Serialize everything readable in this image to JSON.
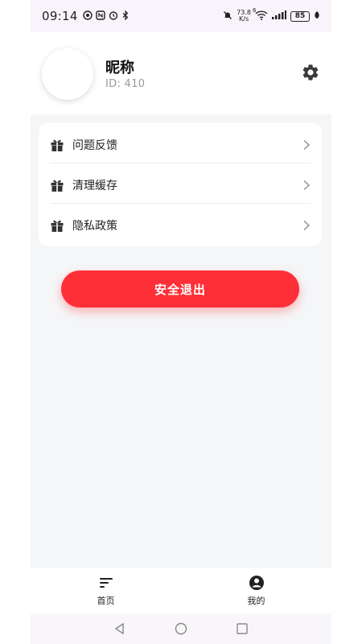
{
  "status_bar": {
    "time": "09:14",
    "net_speed_value": "73.8",
    "net_speed_unit": "K/s",
    "wifi_label": "6",
    "battery": "85"
  },
  "profile": {
    "nickname": "昵称",
    "id_text": "ID:  410"
  },
  "menu": {
    "items": [
      {
        "label": "问题反馈",
        "icon": "gift-icon"
      },
      {
        "label": "清理缓存",
        "icon": "gift-icon"
      },
      {
        "label": "隐私政策",
        "icon": "gift-icon"
      }
    ]
  },
  "logout": {
    "label": "安全退出",
    "color": "#fe2f37"
  },
  "tabbar": {
    "tabs": [
      {
        "label": "首页",
        "icon": "menu-lines-icon"
      },
      {
        "label": "我的",
        "icon": "user-circle-icon"
      }
    ]
  },
  "colors": {
    "accent": "#fe2f37",
    "page_bg": "#f5f6f8",
    "card_bg": "#ffffff"
  }
}
